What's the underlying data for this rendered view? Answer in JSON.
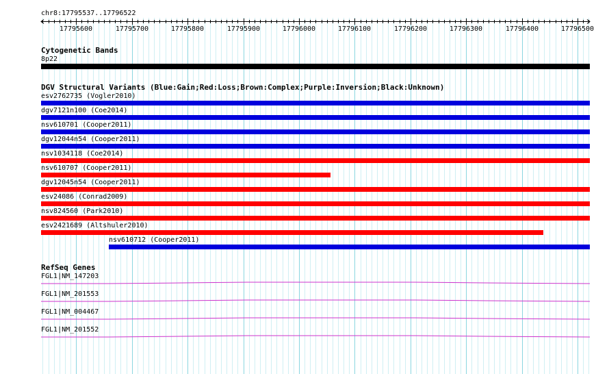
{
  "ruler": {
    "region_label": "chr8:17795537..17796522",
    "start": 17795537,
    "end": 17796522,
    "tick_labels": [
      "17795600",
      "17795700",
      "17795800",
      "17795900",
      "17796000",
      "17796100",
      "17796200",
      "17796300",
      "17796400",
      "17796500"
    ]
  },
  "colors": {
    "grid_minor": "#cfeff3",
    "grid_major": "#8ad6e0",
    "band": "#000000",
    "gain": "#0000dd",
    "loss": "#ff0000",
    "gene": "#cc33cc"
  },
  "tracks": {
    "cytoband": {
      "title": "Cytogenetic Bands",
      "features": [
        {
          "label": "8p22",
          "start": 17795537,
          "end": 17796522,
          "color": "#000000"
        }
      ]
    },
    "dgv": {
      "title": "DGV Structural Variants (Blue:Gain;Red:Loss;Brown:Complex;Purple:Inversion;Black:Unknown)",
      "features": [
        {
          "label": "esv2762735 (Vogler2010)",
          "start": 17795537,
          "end": 17796522,
          "color": "#0000dd"
        },
        {
          "label": "dgv7121n100 (Coe2014)",
          "start": 17795537,
          "end": 17796522,
          "color": "#0000dd"
        },
        {
          "label": "nsv610701 (Cooper2011)",
          "start": 17795537,
          "end": 17796522,
          "color": "#0000dd"
        },
        {
          "label": "dgv12044n54 (Cooper2011)",
          "start": 17795537,
          "end": 17796522,
          "color": "#0000dd"
        },
        {
          "label": "nsv1034118 (Coe2014)",
          "start": 17795537,
          "end": 17796522,
          "color": "#ff0000"
        },
        {
          "label": "nsv610707 (Cooper2011)",
          "start": 17795537,
          "end": 17796057,
          "color": "#ff0000"
        },
        {
          "label": "dgv12045n54 (Cooper2011)",
          "start": 17795537,
          "end": 17796522,
          "color": "#ff0000"
        },
        {
          "label": "esv24086 (Conrad2009)",
          "start": 17795537,
          "end": 17796522,
          "color": "#ff0000"
        },
        {
          "label": "nsv824560 (Park2010)",
          "start": 17795537,
          "end": 17796522,
          "color": "#ff0000"
        },
        {
          "label": "esv2421689 (Altshuler2010)",
          "start": 17795537,
          "end": 17796438,
          "color": "#ff0000"
        },
        {
          "label": "nsv610712 (Cooper2011)",
          "start": 17795659,
          "end": 17796522,
          "color": "#0000dd"
        }
      ]
    },
    "refseq": {
      "title": "RefSeq Genes",
      "features": [
        {
          "label": "FGL1|NM_147203",
          "start": 17795537,
          "end": 17796522,
          "color": "#cc33cc"
        },
        {
          "label": "FGL1|NM_201553",
          "start": 17795537,
          "end": 17796522,
          "color": "#cc33cc"
        },
        {
          "label": "FGL1|NM_004467",
          "start": 17795537,
          "end": 17796522,
          "color": "#cc33cc"
        },
        {
          "label": "FGL1|NM_201552",
          "start": 17795537,
          "end": 17796522,
          "color": "#cc33cc"
        }
      ]
    }
  }
}
